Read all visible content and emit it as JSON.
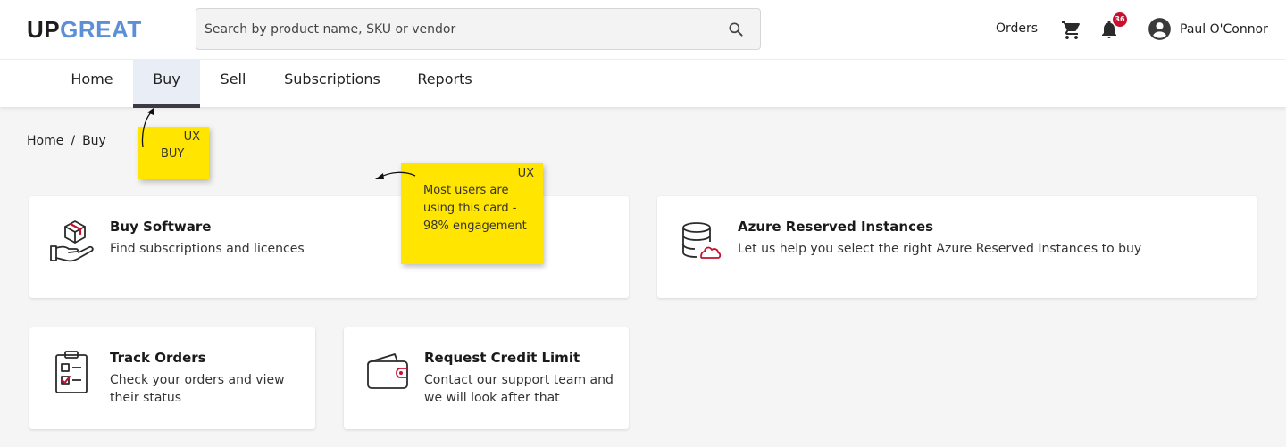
{
  "header": {
    "logo_part1": "UP",
    "logo_part2": "GREAT",
    "search_placeholder": "Search by product name, SKU or vendor",
    "orders_label": "Orders",
    "notification_count": "36",
    "user_name": "Paul O'Connor"
  },
  "nav": {
    "tabs": [
      {
        "label": "Home",
        "active": false
      },
      {
        "label": "Buy",
        "active": true
      },
      {
        "label": "Sell",
        "active": false
      },
      {
        "label": "Subscriptions",
        "active": false
      },
      {
        "label": "Reports",
        "active": false
      }
    ]
  },
  "breadcrumb": {
    "home": "Home",
    "separator": "/",
    "current": "Buy"
  },
  "cards": {
    "buy_software": {
      "title": "Buy Software",
      "description": "Find subscriptions and licences",
      "icon": "box-hand-icon"
    },
    "azure": {
      "title": "Azure Reserved Instances",
      "description": "Let us help you select the right Azure Reserved Instances to buy",
      "icon": "database-cloud-icon"
    },
    "track_orders": {
      "title": "Track Orders",
      "description": "Check your orders and view their status",
      "icon": "clipboard-checklist-icon"
    },
    "credit_limit": {
      "title": "Request Credit Limit",
      "description": "Contact our support team and we will look after that",
      "icon": "wallet-icon"
    }
  },
  "annotations": {
    "note1": {
      "tag": "UX",
      "text": "BUY"
    },
    "note2": {
      "tag": "UX",
      "text": "Most users are using this card - 98% engagement"
    }
  },
  "colors": {
    "brand_dark": "#1c1c1c",
    "brand_blue": "#5b8fd6",
    "accent_red": "#c8102e",
    "sticky_yellow": "#ffe500",
    "active_tab_bg": "#e8edf6"
  }
}
